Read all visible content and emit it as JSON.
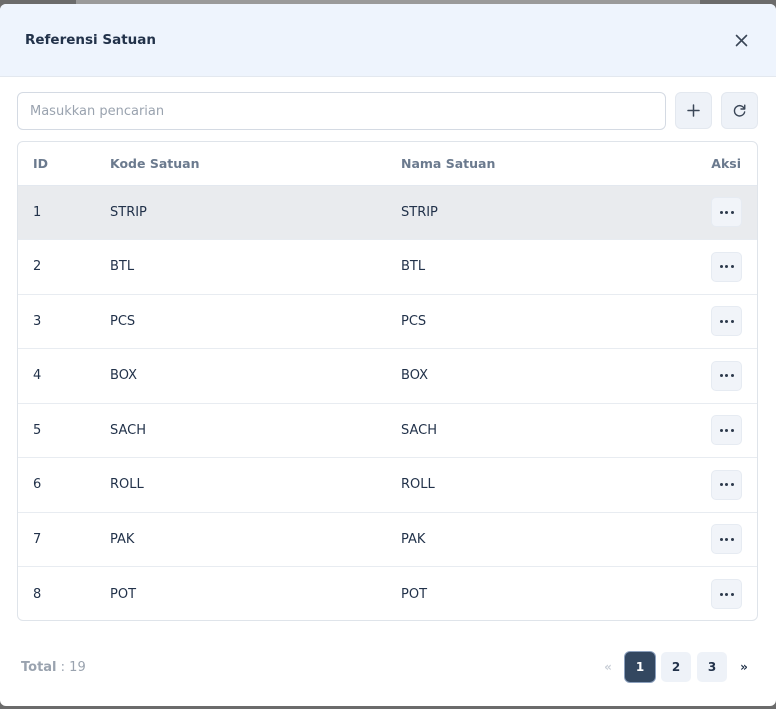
{
  "modal": {
    "title": "Referensi Satuan"
  },
  "search": {
    "placeholder": "Masukkan pencarian",
    "value": ""
  },
  "icons": {
    "close": "close-icon",
    "add": "plus-icon",
    "refresh": "refresh-icon",
    "more": "more-horizontal-icon"
  },
  "table": {
    "headers": {
      "id": "ID",
      "kode": "Kode Satuan",
      "nama": "Nama Satuan",
      "aksi": "Aksi"
    },
    "rows": [
      {
        "id": "1",
        "kode": "STRIP",
        "nama": "STRIP"
      },
      {
        "id": "2",
        "kode": "BTL",
        "nama": "BTL"
      },
      {
        "id": "3",
        "kode": "PCS",
        "nama": "PCS"
      },
      {
        "id": "4",
        "kode": "BOX",
        "nama": "BOX"
      },
      {
        "id": "5",
        "kode": "SACH",
        "nama": "SACH"
      },
      {
        "id": "6",
        "kode": "ROLL",
        "nama": "ROLL"
      },
      {
        "id": "7",
        "kode": "PAK",
        "nama": "PAK"
      },
      {
        "id": "8",
        "kode": "POT",
        "nama": "POT"
      }
    ]
  },
  "footer": {
    "total_label": "Total",
    "total_sep": " : ",
    "total_value": "19"
  },
  "pagination": {
    "prev": "«",
    "pages": [
      "1",
      "2",
      "3"
    ],
    "current": "1",
    "next": "»"
  }
}
